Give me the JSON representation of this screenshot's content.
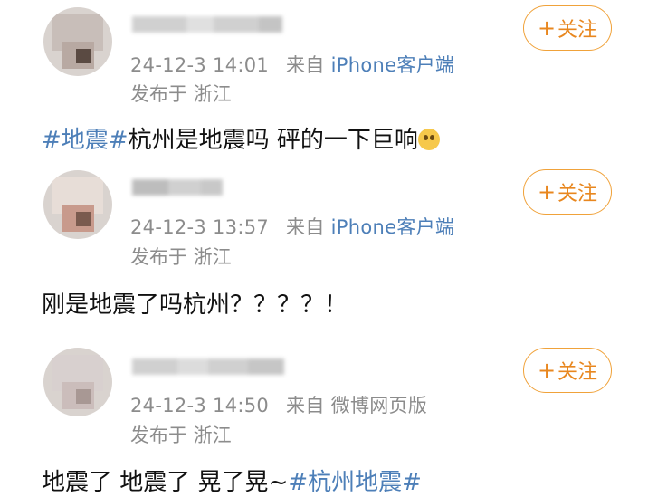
{
  "posts": [
    {
      "timestamp": "24-12-3 14:01",
      "from_label": "来自",
      "source": "iPhone客户端",
      "location": "发布于 浙江",
      "follow_label": "关注",
      "content": {
        "topic": "#地震#",
        "text": "杭州是地震吗 砰的一下巨响",
        "emoji": "confused-face-emoji"
      }
    },
    {
      "timestamp": "24-12-3 13:57",
      "from_label": "来自",
      "source": "iPhone客户端",
      "location": "发布于 浙江",
      "follow_label": "关注",
      "content": {
        "text": "刚是地震了吗杭州？？？？！"
      }
    },
    {
      "timestamp": "24-12-3 14:50",
      "from_label": "来自",
      "source": "微博网页版",
      "location": "发布于 浙江",
      "follow_label": "关注",
      "content": {
        "text": "地震了 地震了 晃了晃~",
        "topic": "#杭州地震#"
      }
    }
  ],
  "colors": {
    "accent_orange": "#e8871f",
    "link_blue": "#4d7fb8",
    "meta_gray": "#8c8c8c"
  }
}
